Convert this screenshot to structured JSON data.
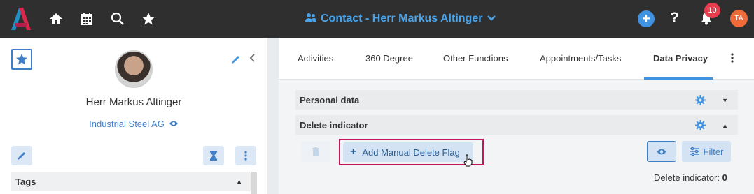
{
  "colors": {
    "topbar": "#2f2f2f",
    "accent": "#3f93e0",
    "badge": "#e83d4e",
    "avatar": "#ef6b3c",
    "highlight_outline": "#c2185b"
  },
  "topbar": {
    "icons": [
      "logo-icon",
      "home-icon",
      "calendar-icon",
      "search-icon",
      "star-icon"
    ],
    "title": "Contact - Herr Markus Altinger",
    "notifications_count": "10",
    "user_initials": "TA",
    "help_label": "?"
  },
  "contact": {
    "name": "Herr Markus Altinger",
    "company": "Industrial Steel AG"
  },
  "left_panel": {
    "tags_label": "Tags"
  },
  "tabs": [
    {
      "label": "Activities"
    },
    {
      "label": "360 Degree"
    },
    {
      "label": "Other Functions"
    },
    {
      "label": "Appointments/Tasks"
    },
    {
      "label": "Data Privacy",
      "active": true
    }
  ],
  "sections": {
    "personal_data": "Personal data",
    "delete_indicator": "Delete indicator"
  },
  "actions": {
    "add_manual_delete_flag": "Add Manual Delete Flag",
    "filter": "Filter"
  },
  "status": {
    "delete_indicator_label": "Delete indicator:",
    "delete_indicator_value": "0"
  }
}
